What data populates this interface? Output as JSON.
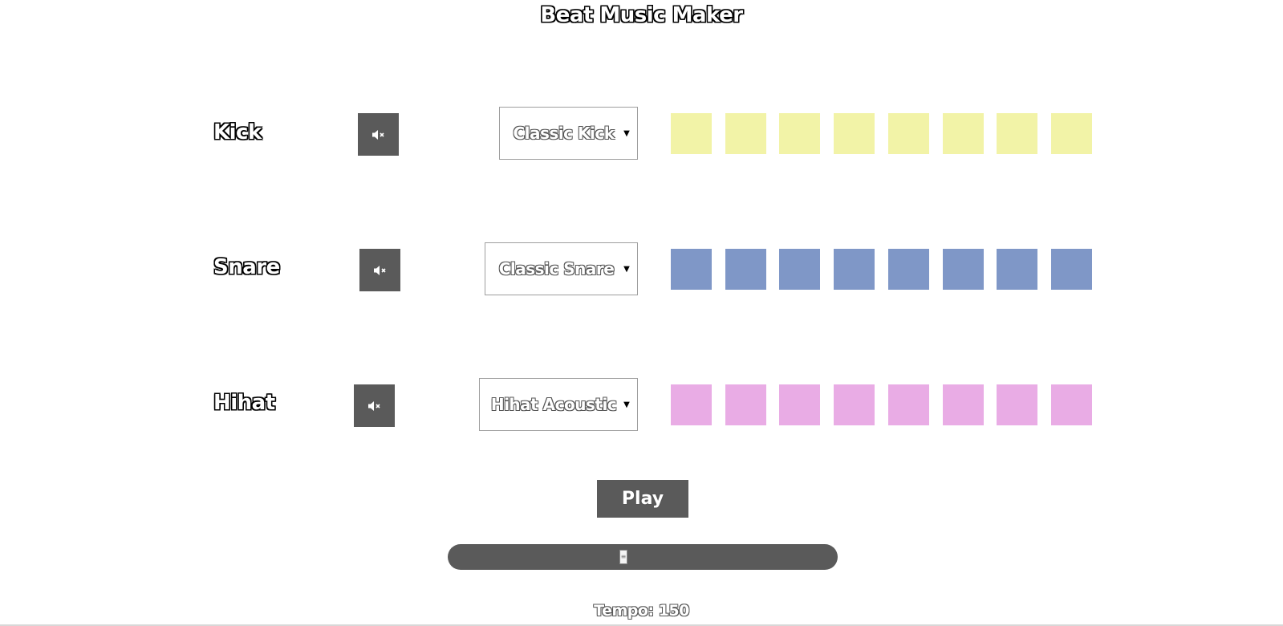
{
  "app": {
    "title": "Beat Music Maker"
  },
  "tracks": [
    {
      "id": "kick",
      "label": "Kick",
      "mute_icon": "speaker-mute-icon",
      "sound": "Classic Kick",
      "pad_color": "#f2f3a7",
      "steps": 8
    },
    {
      "id": "snare",
      "label": "Snare",
      "mute_icon": "speaker-mute-icon",
      "sound": "Classic Snare",
      "pad_color": "#7f97c7",
      "steps": 8
    },
    {
      "id": "hihat",
      "label": "Hihat",
      "mute_icon": "speaker-mute-icon",
      "sound": "Hihat Acoustic",
      "pad_color": "#e9ace5",
      "steps": 8
    }
  ],
  "controls": {
    "play_label": "Play",
    "tempo_text": "Tempo: 150",
    "tempo_slider_fraction": 0.45
  },
  "colors": {
    "control_bg": "#5a5a5a"
  }
}
